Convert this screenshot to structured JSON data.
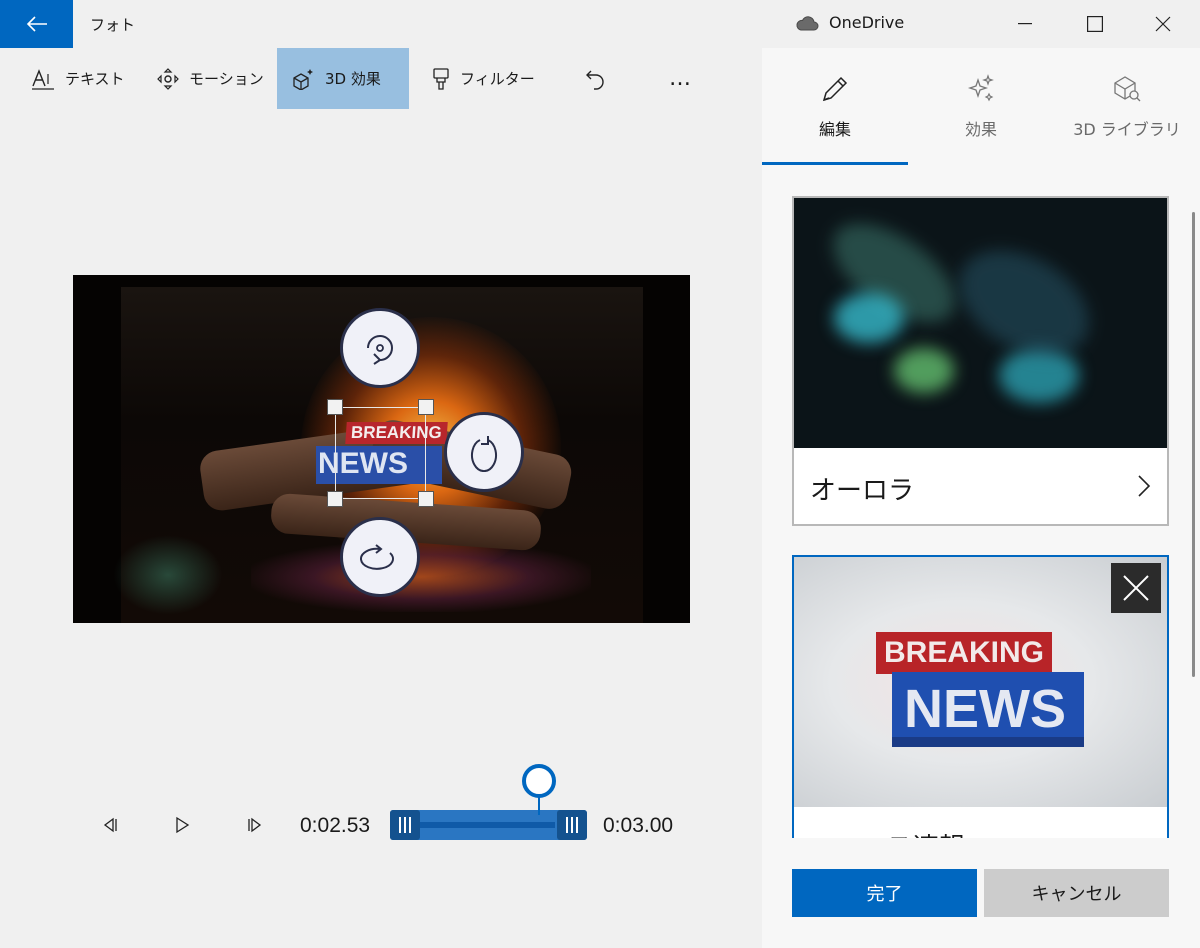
{
  "app": {
    "title": "フォト"
  },
  "titlebar": {
    "onedrive_label": "OneDrive"
  },
  "toolbar": {
    "items": [
      {
        "label": "テキスト",
        "icon": "text-icon",
        "active": false
      },
      {
        "label": "モーション",
        "icon": "motion-icon",
        "active": false
      },
      {
        "label": "3D 効果",
        "icon": "3d-effects-icon",
        "active": true
      },
      {
        "label": "フィルター",
        "icon": "filter-icon",
        "active": false
      }
    ],
    "undo_icon": "undo-icon",
    "more_label": "…"
  },
  "preview": {
    "overlay_small": "BREAKING",
    "overlay_big": "NEWS"
  },
  "playback": {
    "current_time": "0:02.53",
    "end_time": "0:03.00"
  },
  "panel": {
    "tabs": [
      {
        "label": "編集",
        "icon": "pencil-icon",
        "active": true
      },
      {
        "label": "効果",
        "icon": "sparkle-icon",
        "active": false
      },
      {
        "label": "3D ライブラリ",
        "icon": "3d-library-icon",
        "active": false
      }
    ],
    "cards": [
      {
        "label": "オーロラ",
        "selected": false
      },
      {
        "label": "ニュース速報",
        "thumb_small": "BREAKING",
        "thumb_big": "NEWS",
        "selected": true
      }
    ],
    "done_label": "完了",
    "cancel_label": "キャンセル"
  },
  "colors": {
    "accent": "#0067c0",
    "active_tool": "#98bfe0"
  }
}
